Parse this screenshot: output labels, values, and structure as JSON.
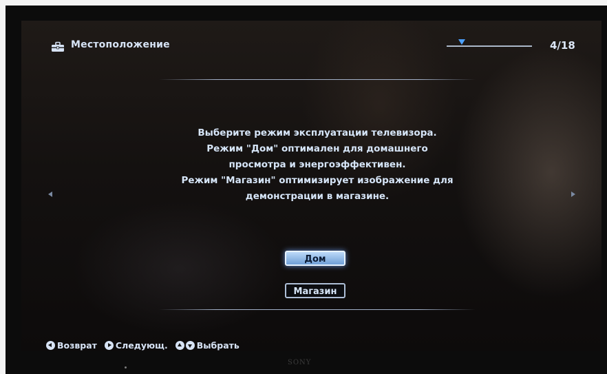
{
  "header": {
    "title": "Местоположение",
    "icon": "toolbox-icon",
    "progress": {
      "current": 4,
      "total": 18,
      "label": "4/18"
    }
  },
  "main": {
    "message_lines": [
      "Выберите режим эксплуатации телевизора.",
      "Режим \"Дом\" оптимален для домашнего",
      "просмотра и энергоэффективен.",
      "Режим \"Магазин\" оптимизирует изображение для",
      "демонстрации в магазине."
    ],
    "options": [
      {
        "label": "Дом",
        "selected": true
      },
      {
        "label": "Магазин",
        "selected": false
      }
    ]
  },
  "footer": {
    "hints": [
      {
        "icon": "back-button-icon",
        "label": "Возврат"
      },
      {
        "icon": "next-button-icon",
        "label": "Следующ."
      },
      {
        "icon": "up-down-button-icon",
        "label": "Выбрать"
      }
    ]
  },
  "device": {
    "brand": "SONY"
  },
  "colors": {
    "accent": "#6f9fd6",
    "text": "#d7e3f5",
    "marker": "#4ca0ff"
  }
}
